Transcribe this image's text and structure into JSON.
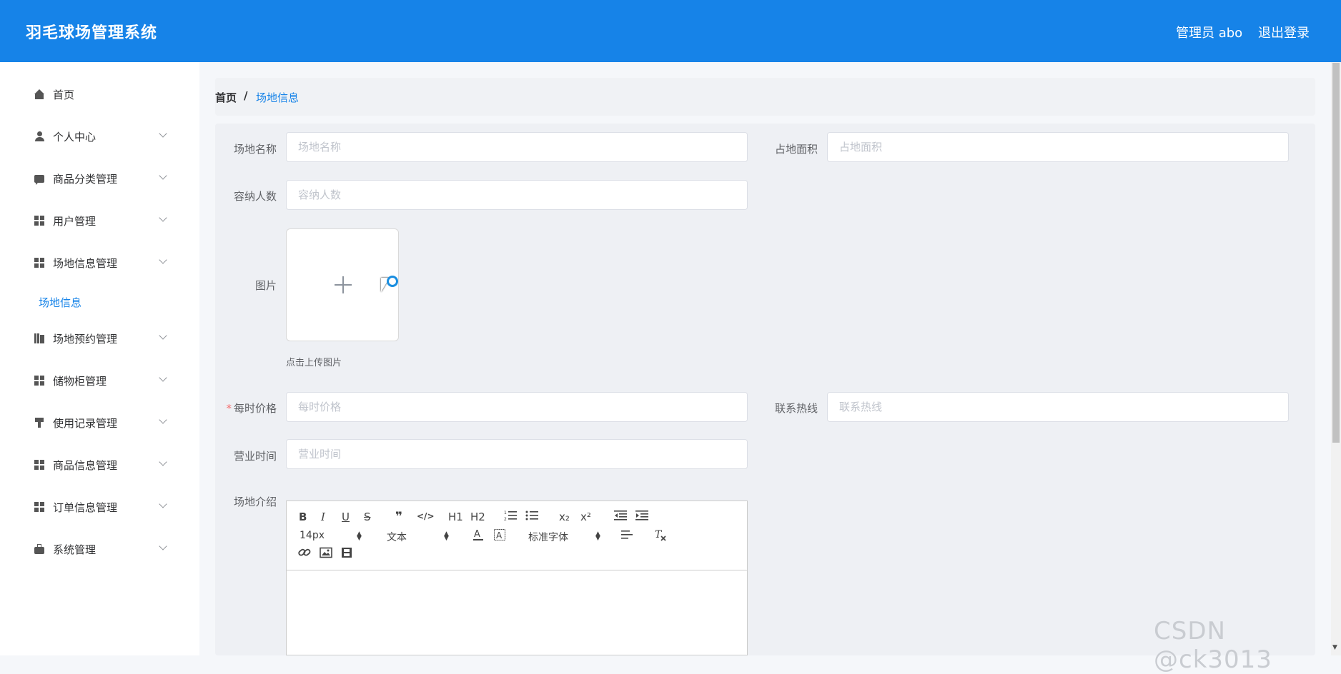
{
  "header": {
    "title": "羽毛球场管理系统",
    "admin_label": "管理员 abo",
    "logout_label": "退出登录"
  },
  "sidebar": {
    "items": [
      {
        "label": "首页",
        "icon": "home-icon"
      },
      {
        "label": "个人中心",
        "icon": "user-icon"
      },
      {
        "label": "商品分类管理",
        "icon": "chat-icon"
      },
      {
        "label": "用户管理",
        "icon": "grid-icon"
      },
      {
        "label": "场地信息管理",
        "icon": "grid-icon"
      },
      {
        "label": "场地预约管理",
        "icon": "book-icon"
      },
      {
        "label": "储物柜管理",
        "icon": "grid-icon"
      },
      {
        "label": "使用记录管理",
        "icon": "stamp-icon"
      },
      {
        "label": "商品信息管理",
        "icon": "grid-icon"
      },
      {
        "label": "订单信息管理",
        "icon": "grid-icon"
      },
      {
        "label": "系统管理",
        "icon": "briefcase-icon"
      }
    ],
    "active_sub": "场地信息"
  },
  "breadcrumb": {
    "home": "首页",
    "separator": "/",
    "current": "场地信息"
  },
  "form": {
    "name_label": "场地名称",
    "name_placeholder": "场地名称",
    "area_label": "占地面积",
    "area_placeholder": "占地面积",
    "capacity_label": "容纳人数",
    "capacity_placeholder": "容纳人数",
    "image_label": "图片",
    "upload_tip": "点击上传图片",
    "price_required_mark": "*",
    "price_label": "每时价格",
    "price_placeholder": "每时价格",
    "hotline_label": "联系热线",
    "hotline_placeholder": "联系热线",
    "hours_label": "营业时间",
    "hours_placeholder": "营业时间",
    "intro_label": "场地介绍"
  },
  "editor": {
    "font_size": "14px",
    "header_select": "文本",
    "font_family": "标准字体",
    "buttons": {
      "bold": "B",
      "italic": "I",
      "underline": "U",
      "strike": "S",
      "quote": "❞",
      "code": "</>",
      "h1": "H1",
      "h2": "H2",
      "subscript": "x₂",
      "superscript": "x²"
    }
  },
  "watermark": "CSDN @ck3013",
  "colors": {
    "header_bg": "#1683e8",
    "accent": "#1683e8",
    "required": "#f56c6c"
  }
}
